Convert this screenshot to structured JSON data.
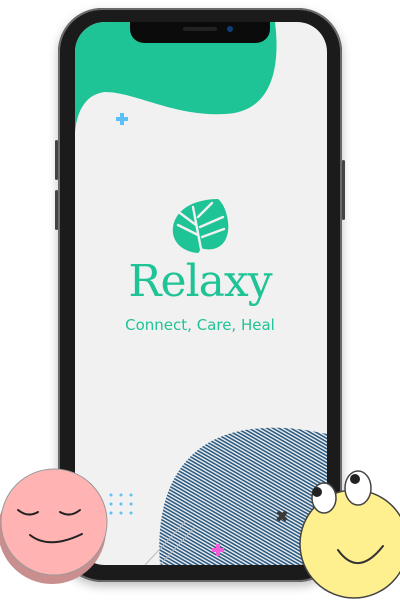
{
  "app": {
    "name": "Relaxy",
    "tagline": "Connect, Care, Heal"
  },
  "colors": {
    "brand": "#1ec396",
    "wave_bottom": "#2a5a82",
    "pink_face": "#ffb3b3",
    "yellow_face": "#fff08f",
    "plus_blue": "#5bc0f8",
    "plus_pink": "#f65cd8"
  },
  "icons": [
    "monstera-leaf-logo",
    "plus-icon",
    "sleeping-face",
    "rolling-eyes-face"
  ]
}
